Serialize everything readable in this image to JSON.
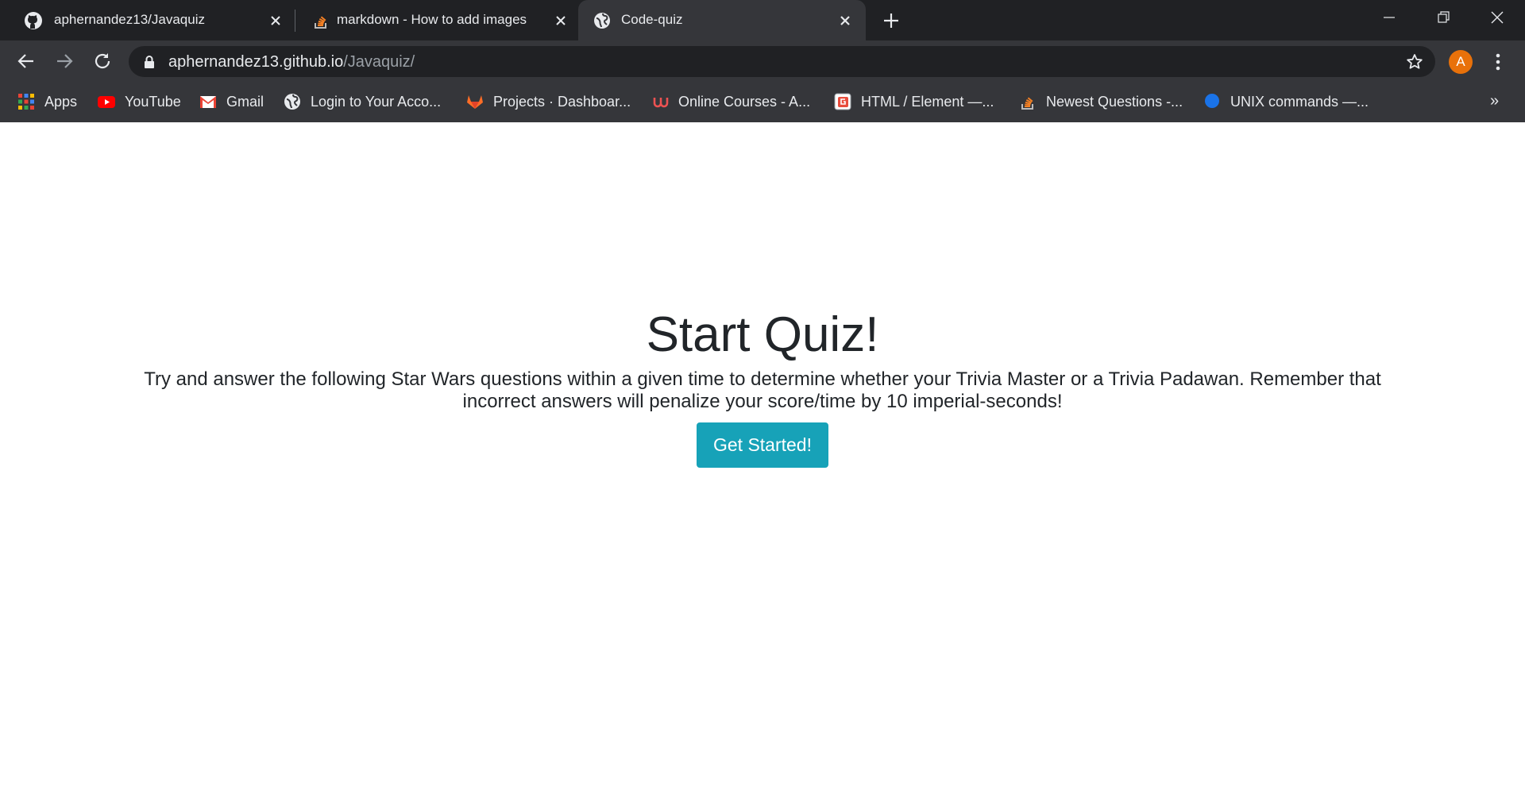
{
  "tabs": [
    {
      "title": "aphernandez13/Javaquiz",
      "icon": "github-icon"
    },
    {
      "title": "markdown - How to add images",
      "icon": "stackoverflow-icon"
    },
    {
      "title": "Code-quiz",
      "icon": "globe-icon",
      "active": true
    }
  ],
  "toolbar": {
    "url_host": "aphernandez13.github.io",
    "url_path": "/Javaquiz/",
    "avatar_letter": "A"
  },
  "bookmarks": [
    {
      "label": "Apps",
      "icon": "apps-grid-icon"
    },
    {
      "label": "YouTube",
      "icon": "youtube-icon"
    },
    {
      "label": "Gmail",
      "icon": "gmail-icon"
    },
    {
      "label": "Login to Your Acco...",
      "icon": "globe-icon"
    },
    {
      "label": "Projects · Dashboar...",
      "icon": "gitlab-icon"
    },
    {
      "label": "Online Courses - A...",
      "icon": "udemy-icon"
    },
    {
      "label": "HTML / Element —...",
      "icon": "element-icon"
    },
    {
      "label": "Newest Questions -...",
      "icon": "stackoverflow-icon"
    },
    {
      "label": "UNIX commands —...",
      "icon": "blue-dot-icon"
    }
  ],
  "bookmarks_overflow": "»",
  "page": {
    "title": "Start Quiz!",
    "description": "Try and answer the following Star Wars questions within a given time to determine whether your Trivia Master or a Trivia Padawan. Remember that incorrect answers will penalize your score/time by 10 imperial-seconds!",
    "button_label": "Get Started!"
  },
  "colors": {
    "button": "#17a2b8",
    "text": "#212529",
    "avatar": "#e8710a"
  }
}
